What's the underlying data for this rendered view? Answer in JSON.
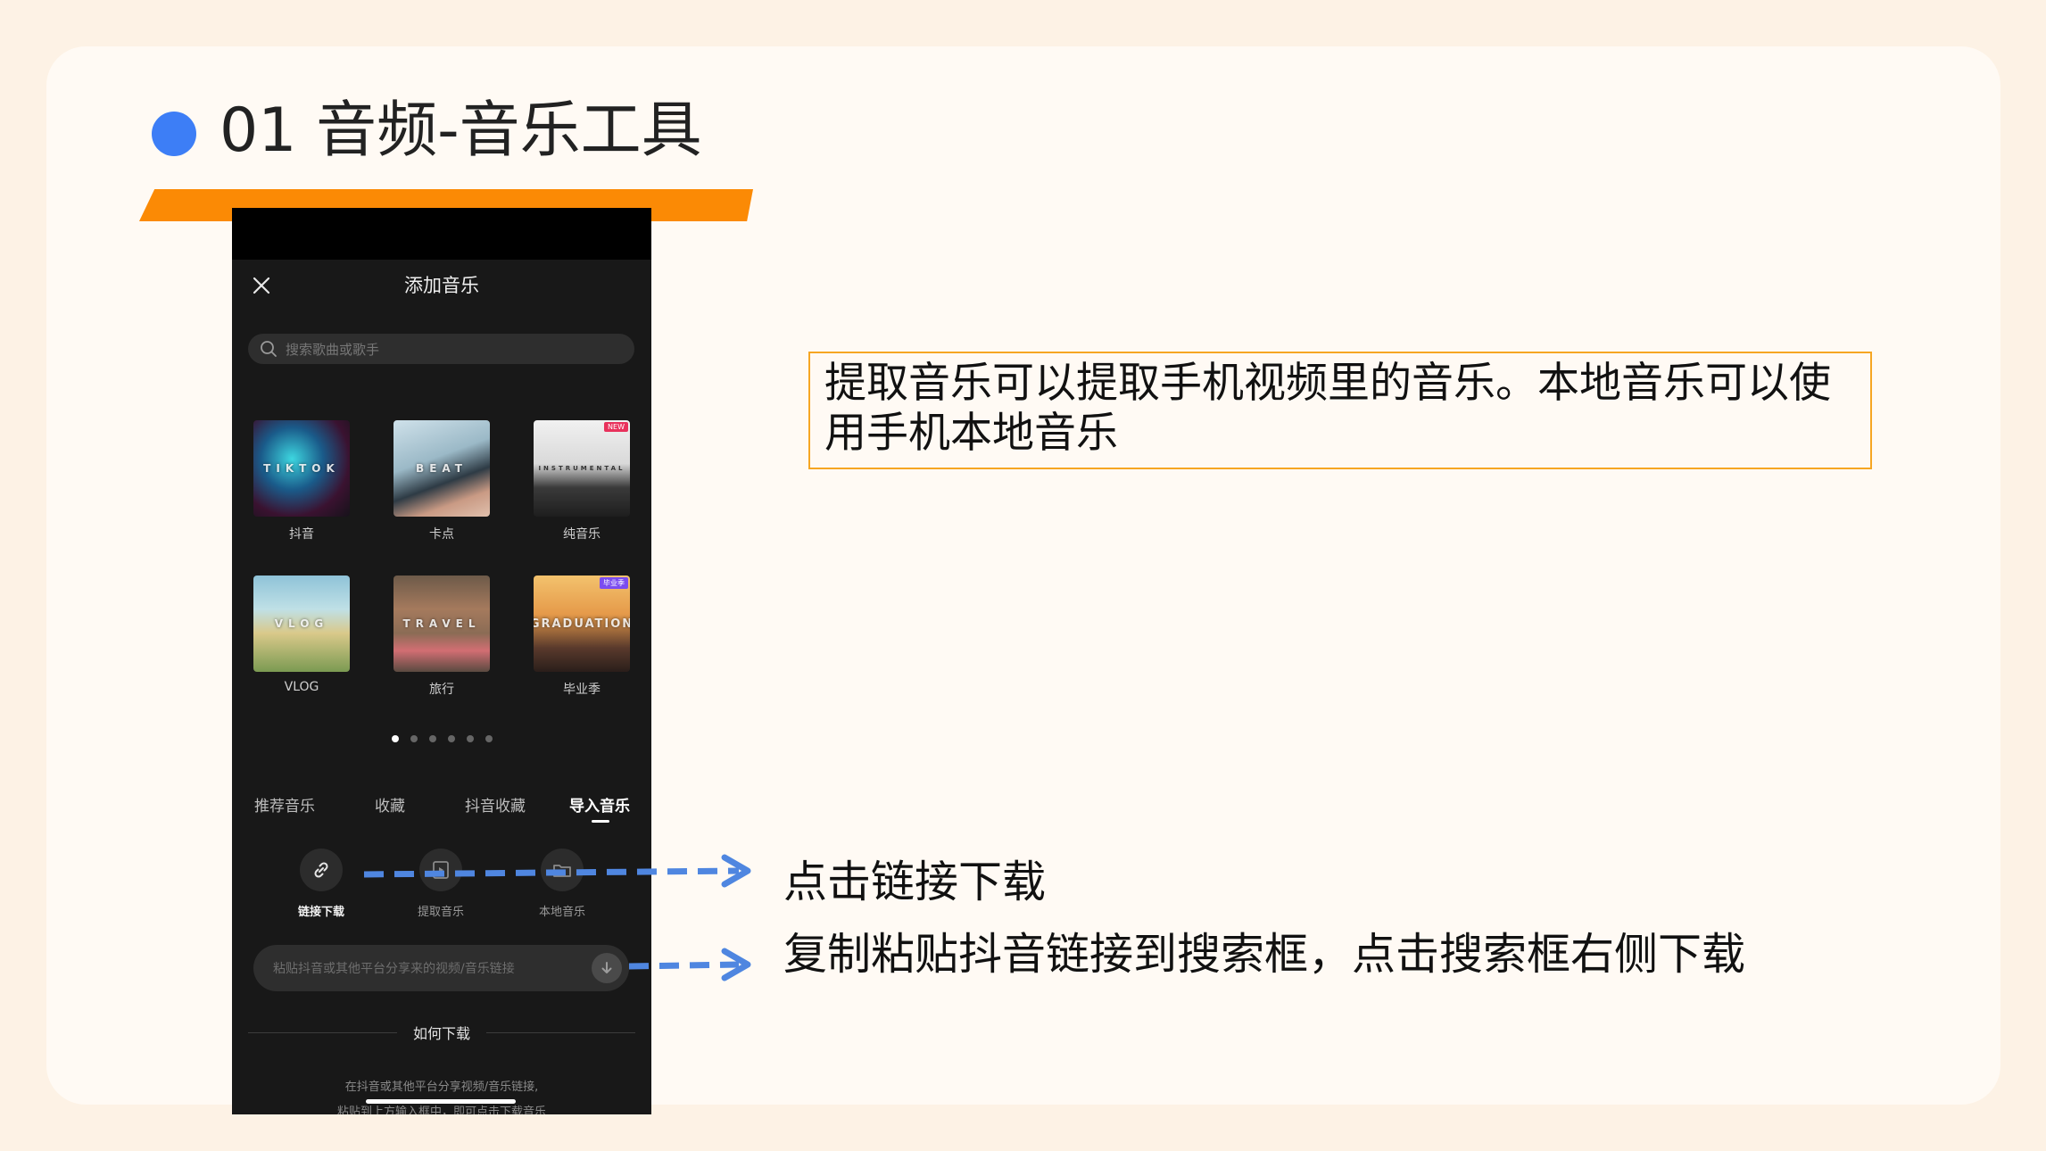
{
  "slide": {
    "title": "01 音频-音乐工具",
    "note": "提取音乐可以提取手机视频里的音乐。本地音乐可以使用手机本地音乐",
    "annotation_link": "点击链接下载",
    "annotation_paste": "复制粘贴抖音链接到搜索框，点击搜索框右侧下载",
    "colors": {
      "accent_blue": "#3d7ef6",
      "accent_orange": "#fb8a05",
      "box_border": "#f6a623",
      "arrow": "#4f86e0"
    }
  },
  "phone": {
    "title": "添加音乐",
    "search_placeholder": "搜索歌曲或歌手",
    "categories": [
      {
        "label": "抖音",
        "art": "TIKTOK"
      },
      {
        "label": "卡点",
        "art": "BEAT"
      },
      {
        "label": "纯音乐",
        "art": "INSTRUMENTAL",
        "badge": "NEW"
      },
      {
        "label": "VLOG",
        "art": "VLOG"
      },
      {
        "label": "旅行",
        "art": "TRAVEL"
      },
      {
        "label": "毕业季",
        "art": "GRADUATION",
        "badge": "毕业季"
      }
    ],
    "tabs": [
      "推荐音乐",
      "收藏",
      "抖音收藏",
      "导入音乐"
    ],
    "active_tab": "导入音乐",
    "import_options": [
      "链接下载",
      "提取音乐",
      "本地音乐"
    ],
    "paste_placeholder": "粘贴抖音或其他平台分享来的视频/音乐链接",
    "how_to_title": "如何下载",
    "help_line1": "在抖音或其他平台分享视频/音乐链接,",
    "help_line2": "粘贴到上方输入框中，即可点击下载音乐",
    "icons": [
      "close-icon",
      "search-icon",
      "link-icon",
      "extract-video-icon",
      "folder-icon",
      "download-icon"
    ]
  }
}
